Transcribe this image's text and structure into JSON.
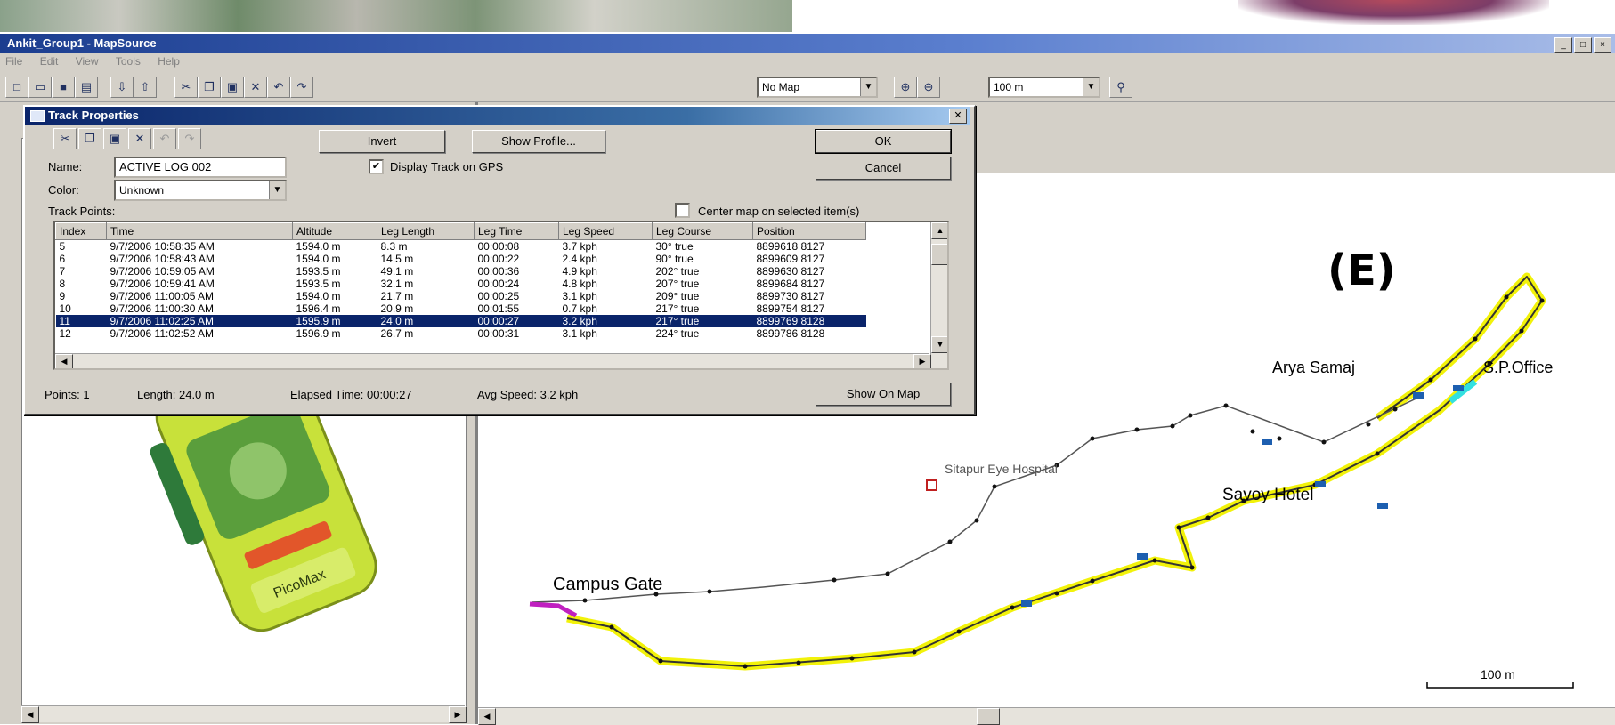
{
  "app": {
    "title": "Ankit_Group1 - MapSource",
    "menu": [
      "File",
      "Edit",
      "View",
      "Tools",
      "Help"
    ],
    "window_controls": [
      "_",
      "□",
      "×"
    ]
  },
  "toolbar": {
    "map_select": "No Map",
    "zoom_select": "100 m",
    "icons": [
      "new-icon",
      "open-icon",
      "save-icon",
      "print-icon",
      "receive-icon",
      "send-icon",
      "cut-icon",
      "copy-icon",
      "paste-icon",
      "delete-icon",
      "undo-icon",
      "redo-icon",
      "zoom-in-icon",
      "zoom-out-icon",
      "find-icon"
    ]
  },
  "dialog": {
    "title": "Track Properties",
    "invert_label": "Invert",
    "show_profile_label": "Show Profile...",
    "ok_label": "OK",
    "cancel_label": "Cancel",
    "name_label": "Name:",
    "name_value": "ACTIVE LOG 002",
    "color_label": "Color:",
    "color_value": "Unknown",
    "display_track_label": "Display Track on GPS",
    "display_track_checked": true,
    "center_map_label": "Center map on selected item(s)",
    "center_map_checked": false,
    "track_points_label": "Track Points:",
    "columns": [
      "Index",
      "Time",
      "Altitude",
      "Leg Length",
      "Leg Time",
      "Leg Speed",
      "Leg Course",
      "Position"
    ],
    "rows": [
      {
        "index": "5",
        "time": "9/7/2006 10:58:35 AM",
        "altitude": "1594.0 m",
        "leg_length": "8.3 m",
        "leg_time": "00:00:08",
        "leg_speed": "3.7 kph",
        "leg_course": "30° true",
        "position": "8899618 8127"
      },
      {
        "index": "6",
        "time": "9/7/2006 10:58:43 AM",
        "altitude": "1594.0 m",
        "leg_length": "14.5 m",
        "leg_time": "00:00:22",
        "leg_speed": "2.4 kph",
        "leg_course": "90° true",
        "position": "8899609 8127"
      },
      {
        "index": "7",
        "time": "9/7/2006 10:59:05 AM",
        "altitude": "1593.5 m",
        "leg_length": "49.1 m",
        "leg_time": "00:00:36",
        "leg_speed": "4.9 kph",
        "leg_course": "202° true",
        "position": "8899630 8127"
      },
      {
        "index": "8",
        "time": "9/7/2006 10:59:41 AM",
        "altitude": "1593.5 m",
        "leg_length": "32.1 m",
        "leg_time": "00:00:24",
        "leg_speed": "4.8 kph",
        "leg_course": "207° true",
        "position": "8899684 8127"
      },
      {
        "index": "9",
        "time": "9/7/2006 11:00:05 AM",
        "altitude": "1594.0 m",
        "leg_length": "21.7 m",
        "leg_time": "00:00:25",
        "leg_speed": "3.1 kph",
        "leg_course": "209° true",
        "position": "8899730 8127"
      },
      {
        "index": "10",
        "time": "9/7/2006 11:00:30 AM",
        "altitude": "1596.4 m",
        "leg_length": "20.9 m",
        "leg_time": "00:01:55",
        "leg_speed": "0.7 kph",
        "leg_course": "217° true",
        "position": "8899754 8127"
      },
      {
        "index": "11",
        "time": "9/7/2006 11:02:25 AM",
        "altitude": "1595.9 m",
        "leg_length": "24.0 m",
        "leg_time": "00:00:27",
        "leg_speed": "3.2 kph",
        "leg_course": "217° true",
        "position": "8899769 8128"
      },
      {
        "index": "12",
        "time": "9/7/2006 11:02:52 AM",
        "altitude": "1596.9 m",
        "leg_length": "26.7 m",
        "leg_time": "00:00:31",
        "leg_speed": "3.1 kph",
        "leg_course": "224° true",
        "position": "8899786 8128"
      }
    ],
    "selected_row": 6,
    "status": {
      "points": "Points: 1",
      "length": "Length: 24.0 m",
      "elapsed": "Elapsed Time: 00:00:27",
      "avg_speed": "Avg Speed: 3.2 kph"
    },
    "show_on_map_label": "Show On Map"
  },
  "map": {
    "panel_letter": "(E)",
    "labels": {
      "arya_samaj": "Arya Samaj",
      "sp_office": "S.P.Office",
      "sitapur_eye_hospital": "Sitapur Eye Hospital",
      "savoy_hotel": "Savoy Hotel",
      "campus_gate": "Campus Gate"
    },
    "scale_label": "100 m",
    "colors": {
      "yellow_track": "#f2f20a",
      "black_track": "#000000",
      "cyan_segment": "#33e0e0",
      "magenta_segment": "#c020c0",
      "hospital_marker": "#c02020"
    }
  },
  "device": {
    "label": "PicoMax"
  }
}
